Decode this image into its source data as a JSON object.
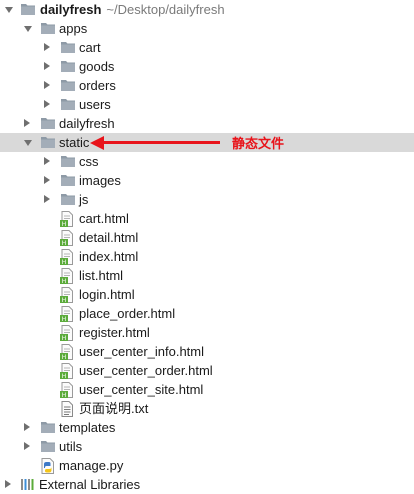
{
  "project": {
    "name": "dailyfresh",
    "path": "~/Desktop/dailyfresh"
  },
  "tree": {
    "apps": "apps",
    "cart": "cart",
    "goods": "goods",
    "orders": "orders",
    "users": "users",
    "dailyfresh": "dailyfresh",
    "static": "static",
    "css": "css",
    "images": "images",
    "js": "js",
    "files": [
      "cart.html",
      "detail.html",
      "index.html",
      "list.html",
      "login.html",
      "place_order.html",
      "register.html",
      "user_center_info.html",
      "user_center_order.html",
      "user_center_site.html",
      "页面说明.txt"
    ],
    "templates": "templates",
    "utils": "utils",
    "manage": "manage.py",
    "external": "External Libraries"
  },
  "annotation": {
    "text": "静态文件",
    "color": "#e8141b"
  },
  "colors": {
    "folder": "#8e9aa6",
    "html_icon_badge": "#5bab3a",
    "selection": "#d9d9d9"
  },
  "icons": {
    "folder": "folder-icon",
    "html": "html-file-icon",
    "text": "text-file-icon",
    "python": "python-file-icon",
    "libraries": "libraries-icon"
  }
}
